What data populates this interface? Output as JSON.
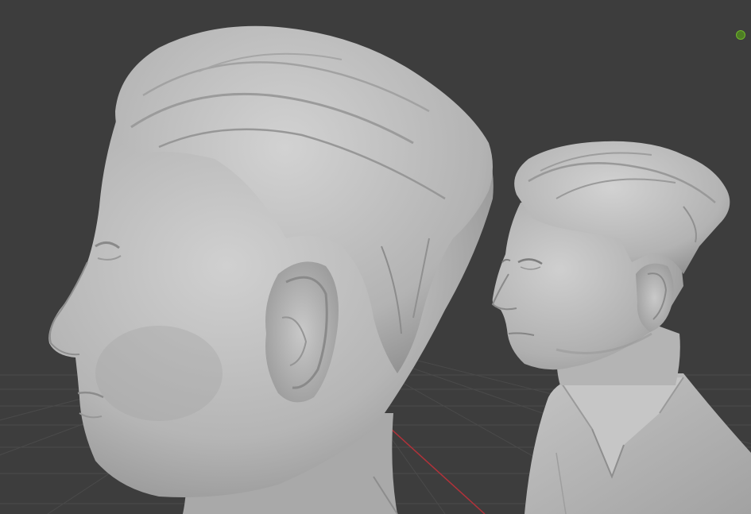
{
  "viewport": {
    "background_color": "#3d3d3d",
    "grid_line_color": "#4a4a4a",
    "x_axis_color": "#b2323a",
    "sculpt_color": "#b9b9b9"
  },
  "objects": {
    "sculpt_side_profile": "head-side-profile",
    "sculpt_three_quarter": "bust-three-quarter"
  },
  "overlay": {
    "indicator_icon": "green-circle-icon",
    "indicator_color": "#6fb72a"
  }
}
